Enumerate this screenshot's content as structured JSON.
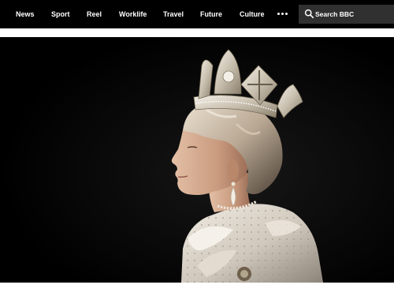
{
  "nav": {
    "items": [
      {
        "label": "News"
      },
      {
        "label": "Sport"
      },
      {
        "label": "Reel"
      },
      {
        "label": "Worklife"
      },
      {
        "label": "Travel"
      },
      {
        "label": "Future"
      },
      {
        "label": "Culture"
      }
    ],
    "more_icon": "more-dots-icon"
  },
  "search": {
    "label": "Search BBC",
    "icon": "search-icon"
  },
  "hero": {
    "image_subject": "portrait of Queen Elizabeth II in profile wearing a crown",
    "background_color": "#000000"
  },
  "colors": {
    "nav_background": "#000000",
    "search_background": "#303030",
    "text": "#ffffff"
  }
}
